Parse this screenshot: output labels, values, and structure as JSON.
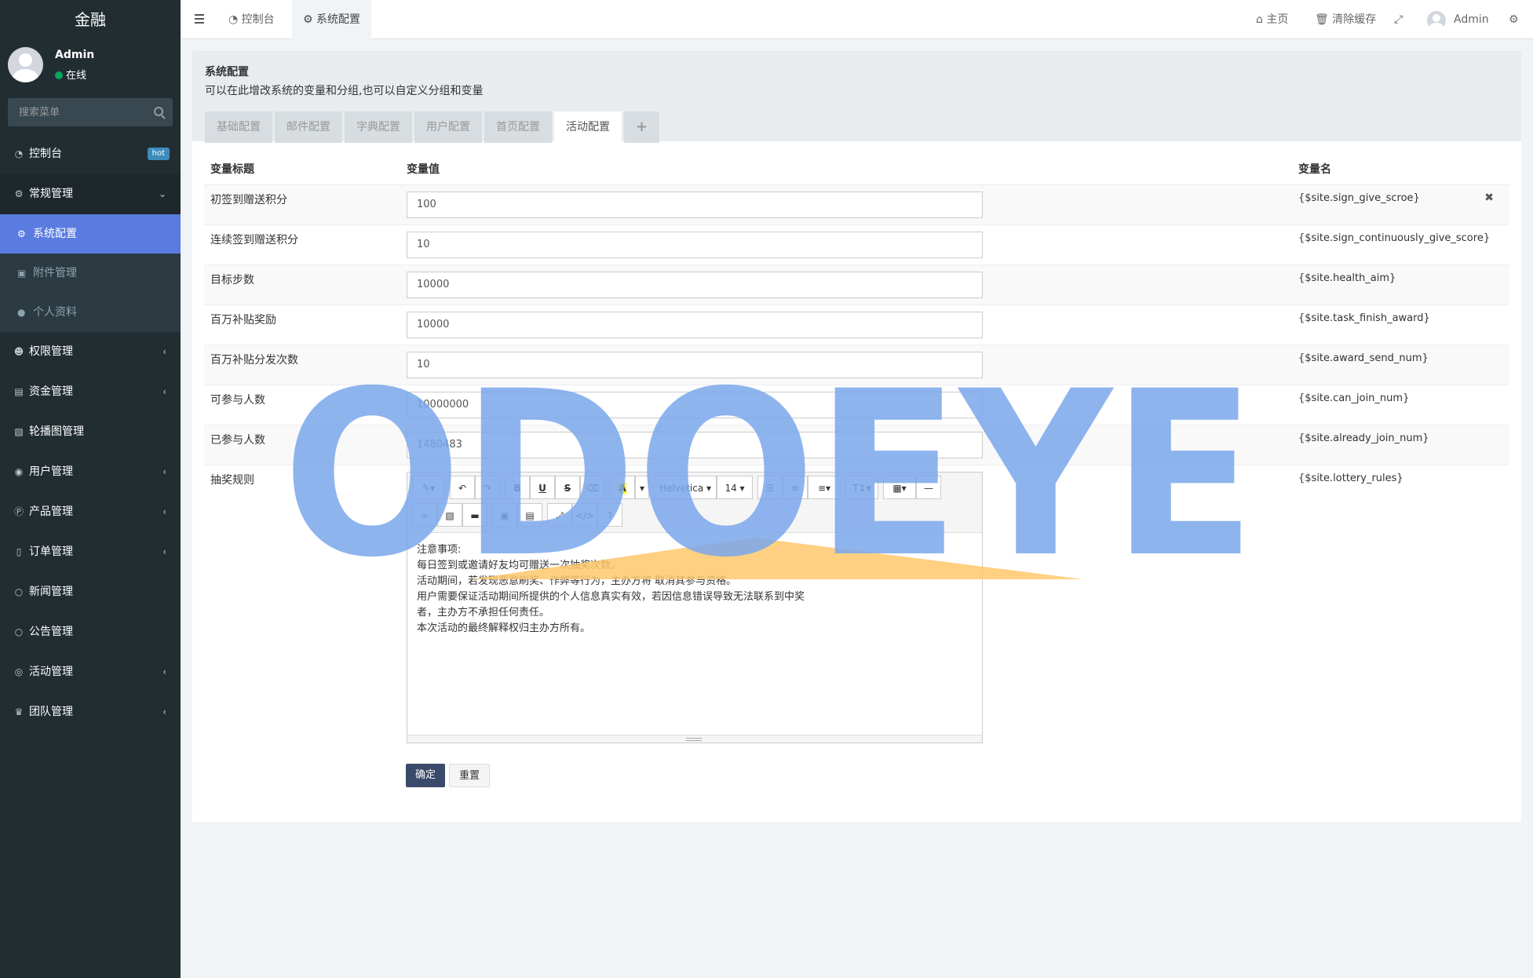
{
  "app": {
    "brand": "金融"
  },
  "user": {
    "name": "Admin",
    "status": "在线"
  },
  "search": {
    "placeholder": "搜索菜单"
  },
  "sidebar": {
    "items": [
      {
        "label": "控制台",
        "badge": "hot"
      },
      {
        "label": "常规管理",
        "open": true,
        "children": [
          {
            "label": "系统配置",
            "active": true
          },
          {
            "label": "附件管理"
          },
          {
            "label": "个人资料"
          }
        ]
      },
      {
        "label": "权限管理"
      },
      {
        "label": "资金管理"
      },
      {
        "label": "轮播图管理"
      },
      {
        "label": "用户管理"
      },
      {
        "label": "产品管理"
      },
      {
        "label": "订单管理"
      },
      {
        "label": "新闻管理"
      },
      {
        "label": "公告管理"
      },
      {
        "label": "活动管理"
      },
      {
        "label": "团队管理"
      }
    ]
  },
  "header": {
    "tabs": [
      {
        "label": "控制台"
      },
      {
        "label": "系统配置"
      }
    ],
    "right": {
      "home": "主页",
      "clear_cache": "清除缓存",
      "admin": "Admin"
    }
  },
  "main": {
    "title": "系统配置",
    "subtitle": "可以在此增改系统的变量和分组,也可以自定义分组和变量",
    "tabs": [
      "基础配置",
      "邮件配置",
      "字典配置",
      "用户配置",
      "首页配置",
      "活动配置",
      "+"
    ],
    "table": {
      "headers": {
        "title": "变量标题",
        "value": "变量值",
        "name": "变量名"
      },
      "rows": [
        {
          "title": "初签到赠送积分",
          "value": "100",
          "name": "{$site.sign_give_scroe}"
        },
        {
          "title": "连续签到赠送积分",
          "value": "10",
          "name": "{$site.sign_continuously_give_score}"
        },
        {
          "title": "目标步数",
          "value": "10000",
          "name": "{$site.health_aim}"
        },
        {
          "title": "百万补贴奖励",
          "value": "10000",
          "name": "{$site.task_finish_award}"
        },
        {
          "title": "百万补贴分发次数",
          "value": "10",
          "name": "{$site.award_send_num}"
        },
        {
          "title": "可参与人数",
          "value": "10000000",
          "name": "{$site.can_join_num}"
        },
        {
          "title": "已参与人数",
          "value": "1480483",
          "name": "{$site.already_join_num}"
        }
      ],
      "rules_row": {
        "title": "抽奖规则",
        "name": "{$site.lottery_rules}",
        "editor": {
          "font": "Helvetica",
          "size": "14",
          "lines": [
            "注意事项:",
            "每日签到或邀请好友均可赠送一次抽奖次数。",
            "活动期间，若发现恶意刷奖、作弊等行为，主办方将 取消其参与资格。",
            "用户需要保证活动期间所提供的个人信息真实有效，若因信息错误导致无法联系到中奖",
            "者，主办方不承担任何责任。",
            "本次活动的最终解释权归主办方所有。"
          ]
        }
      }
    },
    "buttons": {
      "ok": "确定",
      "reset": "重置"
    }
  },
  "watermark": {
    "text": "ODOEYE"
  },
  "colors": {
    "sidebar": "#222d32",
    "active": "#5a7be0",
    "watermark_blue": "#7ba7ec",
    "watermark_orange": "#ffc86b"
  }
}
